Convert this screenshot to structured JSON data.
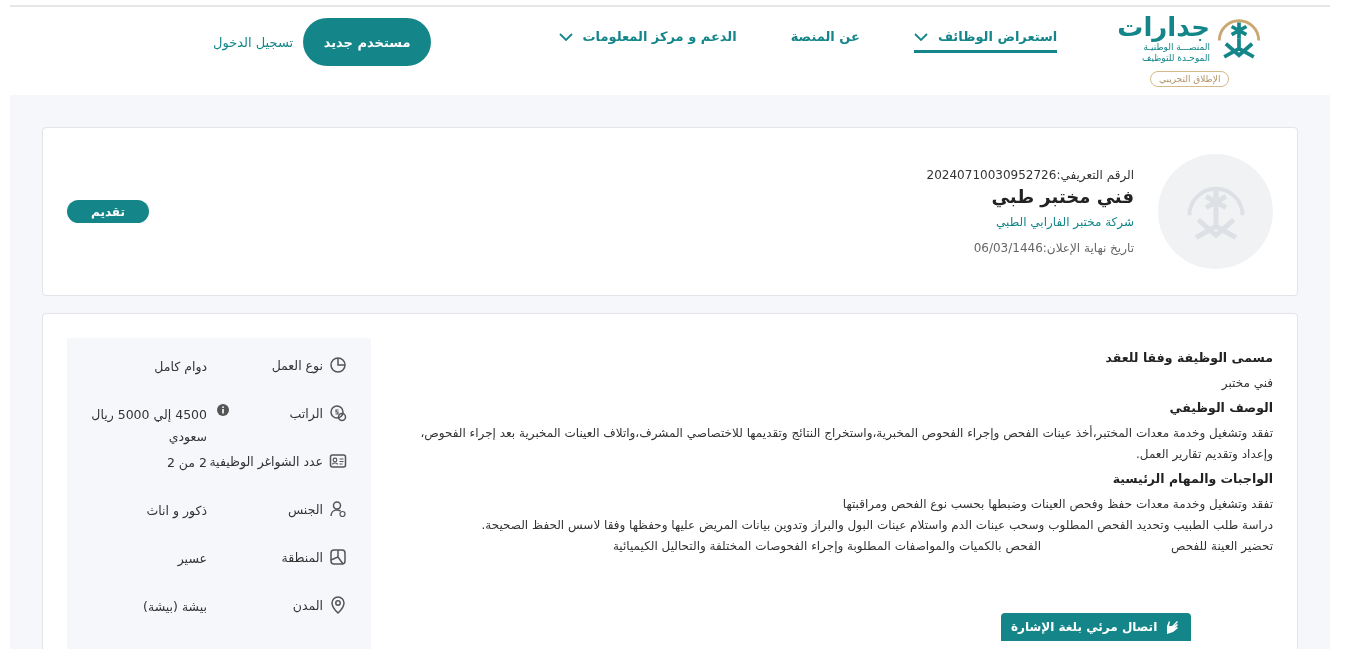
{
  "header": {
    "logo": {
      "name": "جدارات",
      "subtitle_lines": [
        "المنصـــة الوطنيـة",
        "الموحـدة للتوظيف"
      ],
      "badge": "الإطلاق التجريبي"
    },
    "nav": [
      {
        "label": "استعراض الوظائف",
        "dropdown": true,
        "selected": true
      },
      {
        "label": "عن المنصة",
        "dropdown": false,
        "selected": false
      },
      {
        "label": "الدعم و مركز المعلومات",
        "dropdown": true,
        "selected": false
      }
    ],
    "new_user_button": "مستخدم جديد",
    "login_link": "تسجيل الدخول"
  },
  "job_card": {
    "reference": "الرقم التعريفي:20240710030952726",
    "title": "فني مختبر طبي",
    "company": "شركة مختبر الفارابي الطبي",
    "deadline": "تاريخ نهاية الإعلان:06/03/1446",
    "apply_button": "تقديم"
  },
  "details": {
    "sections": [
      {
        "heading": "مسمى الوظيفة وفقا للعقد",
        "paragraphs": [
          "فني مختبر"
        ]
      },
      {
        "heading": "الوصف الوظيفي",
        "paragraphs": [
          "تفقد وتشغيل وخدمة معدات المختبر،أخذ عينات الفحص وإجراء الفحوص المخبرية،واستخراج النتائج وتقديمها للاختصاصي المشرف،واتلاف العينات المخبرية بعد إجراء الفحوص، وإعداد وتقديم تقارير العمل."
        ]
      },
      {
        "heading": "الواجبات والمهام الرئيسية",
        "paragraphs": [
          "تفقد وتشغيل وخدمة معدات حفظ وفحص العينات وضبطها بحسب نوع الفحص ومراقبتها",
          "دراسة طلب الطبيب وتحديد الفحص المطلوب وسحب عينات الدم واستلام عينات البول والبراز وتدوين بيانات المريض عليها وحفظها وفقا لاسس الحفظ الصحيحة.",
          "تحضير العينة للفحص",
          "الفحص بالكميات والمواصفات المطلوبة وإجراء الفحوصات المختلفة والتحاليل الكيميائية"
        ]
      }
    ],
    "facts": [
      {
        "kind": "work-type",
        "label": "نوع العمل",
        "value": "دوام كامل"
      },
      {
        "kind": "salary",
        "label": "الراتب",
        "value": "4500 إلي 5000 ريال سعودي",
        "info": true
      },
      {
        "kind": "vacancies",
        "label": "عدد الشواغر الوظيفية",
        "value": "2  من 2"
      },
      {
        "kind": "gender",
        "label": "الجنس",
        "value": "ذكور و اناث"
      },
      {
        "kind": "region",
        "label": "المنطقة",
        "value": "عسير"
      },
      {
        "kind": "city",
        "label": "المدن",
        "value": "بيشة (بيشة)"
      }
    ]
  },
  "sign_language_button": "اتصال مرئي بلغة الإشارة"
}
